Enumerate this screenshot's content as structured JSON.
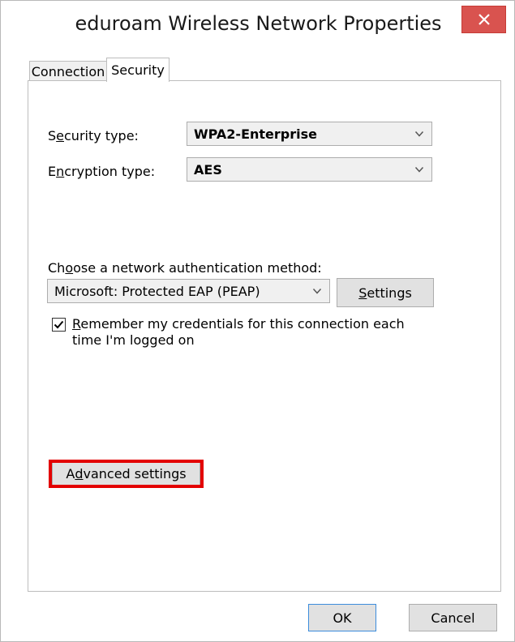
{
  "window": {
    "title": "eduroam Wireless Network Properties",
    "close_icon": "close-icon"
  },
  "tabs": [
    {
      "label": "Connection",
      "selected": false
    },
    {
      "label": "Security",
      "selected": true
    }
  ],
  "security": {
    "security_type_label_pre": "S",
    "security_type_label_acc": "e",
    "security_type_label_post": "curity type:",
    "security_type_value": "WPA2-Enterprise",
    "encryption_type_label_pre": "E",
    "encryption_type_label_acc": "n",
    "encryption_type_label_post": "cryption type:",
    "encryption_type_value": "AES",
    "auth_method_label_pre": "Ch",
    "auth_method_label_acc": "o",
    "auth_method_label_post": "ose a network authentication method:",
    "auth_method_value": "Microsoft: Protected EAP (PEAP)",
    "settings_button_acc": "S",
    "settings_button_rest": "ettings",
    "remember_checked": true,
    "remember_acc": "R",
    "remember_line1_rest": "emember my credentials for this connection each",
    "remember_line2": "time I'm logged on",
    "advanced_acc_pre": "A",
    "advanced_acc": "d",
    "advanced_rest": "vanced settings"
  },
  "footer": {
    "ok_label": "OK",
    "cancel_label": "Cancel"
  },
  "colors": {
    "close_button": "#d9534f",
    "highlight_border": "#e30000",
    "ok_border": "#3c8ddc"
  }
}
